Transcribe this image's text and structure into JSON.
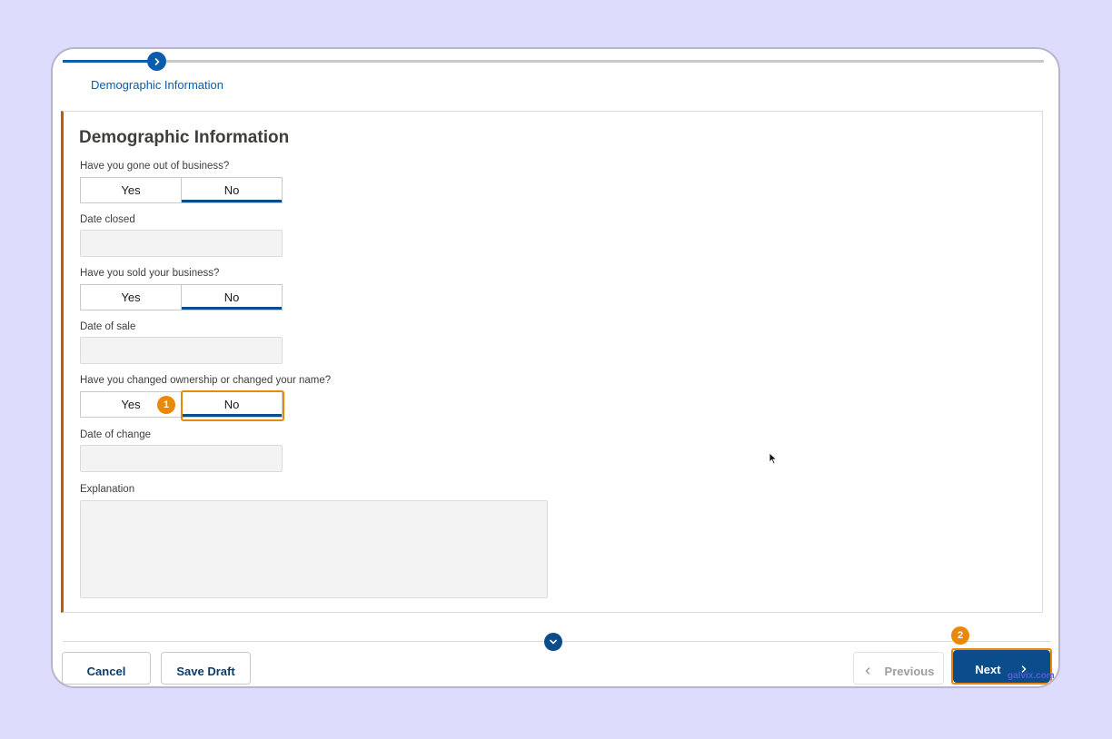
{
  "stepper": {
    "current_step_label": "Demographic Information"
  },
  "form": {
    "title": "Demographic Information",
    "out_of_business": {
      "label": "Have you gone out of business?",
      "yes": "Yes",
      "no": "No",
      "selected": "No"
    },
    "date_closed": {
      "label": "Date closed",
      "value": ""
    },
    "sold_business": {
      "label": "Have you sold your business?",
      "yes": "Yes",
      "no": "No",
      "selected": "No"
    },
    "date_of_sale": {
      "label": "Date of sale",
      "value": ""
    },
    "changed_ownership": {
      "label": "Have you changed ownership or changed your name?",
      "yes": "Yes",
      "no": "No",
      "selected": "No"
    },
    "date_of_change": {
      "label": "Date of change",
      "value": ""
    },
    "explanation": {
      "label": "Explanation",
      "value": ""
    }
  },
  "annotations": {
    "badge_1": "1",
    "badge_2": "2"
  },
  "footer": {
    "cancel": "Cancel",
    "save_draft": "Save Draft",
    "previous": "Previous",
    "next": "Next"
  },
  "watermark": "galvix.com",
  "colors": {
    "accent": "#0b5cab",
    "highlight": "#e8890c",
    "card_border": "#c15b07",
    "background": "#dedcfc"
  }
}
